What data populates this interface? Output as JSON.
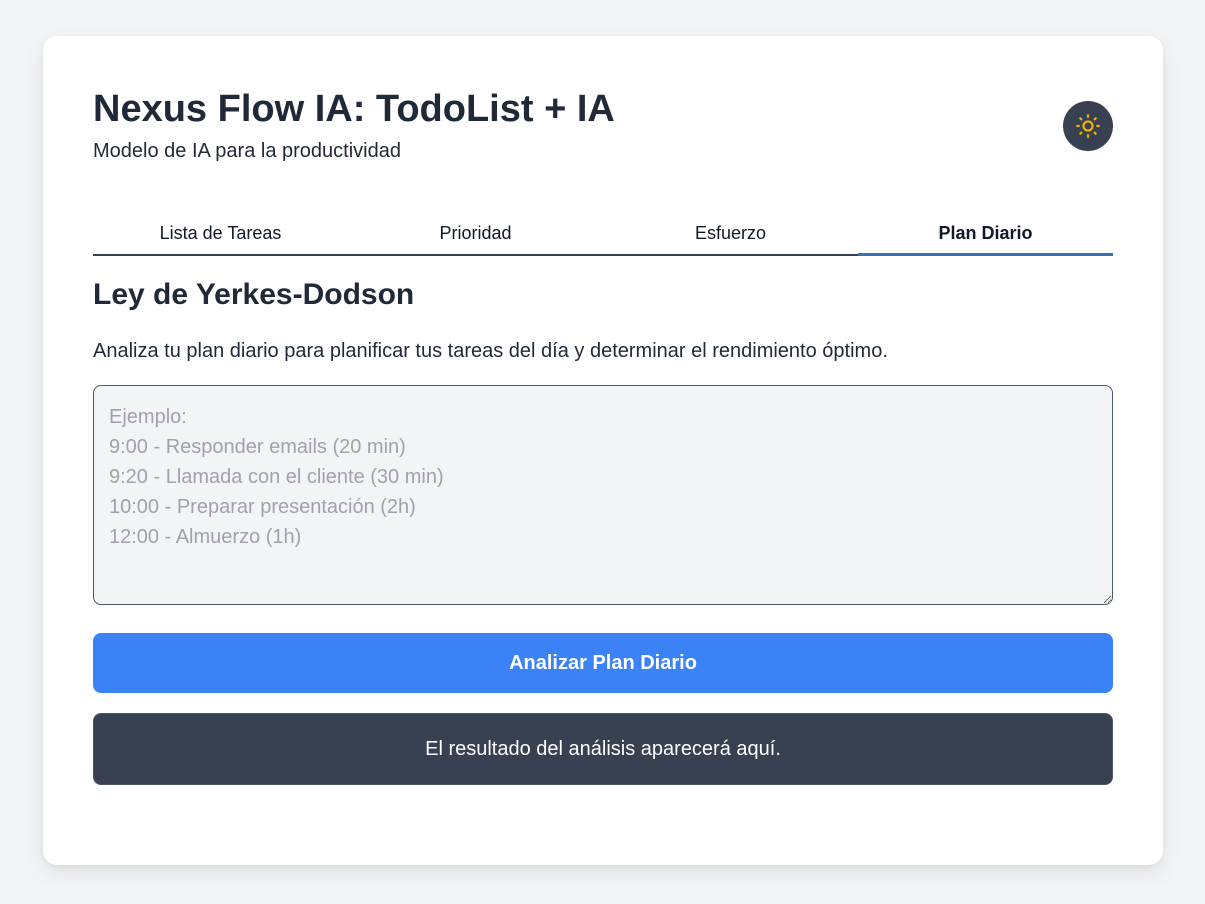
{
  "header": {
    "title": "Nexus Flow IA: TodoList + IA",
    "subtitle": "Modelo de IA para la productividad",
    "theme_toggle_icon": "sun-icon",
    "theme_toggle_bg": "#374151",
    "theme_toggle_icon_color": "#f5b301"
  },
  "tabs": [
    {
      "label": "Lista de Tareas",
      "active": false
    },
    {
      "label": "Prioridad",
      "active": false
    },
    {
      "label": "Esfuerzo",
      "active": false
    },
    {
      "label": "Plan Diario",
      "active": true
    }
  ],
  "main": {
    "section_title": "Ley de Yerkes-Dodson",
    "description": "Analiza tu plan diario para planificar tus tareas del día y determinar el rendimiento óptimo.",
    "input": {
      "value": "",
      "placeholder": "Ejemplo:\n9:00 - Responder emails (20 min)\n9:20 - Llamada con el cliente (30 min)\n10:00 - Preparar presentación (2h)\n12:00 - Almuerzo (1h)"
    },
    "analyze_button_label": "Analizar Plan Diario",
    "result_text": "El resultado del análisis aparecerá aquí."
  },
  "colors": {
    "accent": "#3b82f6",
    "tab_underline": "#3b6fb3",
    "result_bg": "#374151",
    "page_bg": "#f3f4f6"
  }
}
